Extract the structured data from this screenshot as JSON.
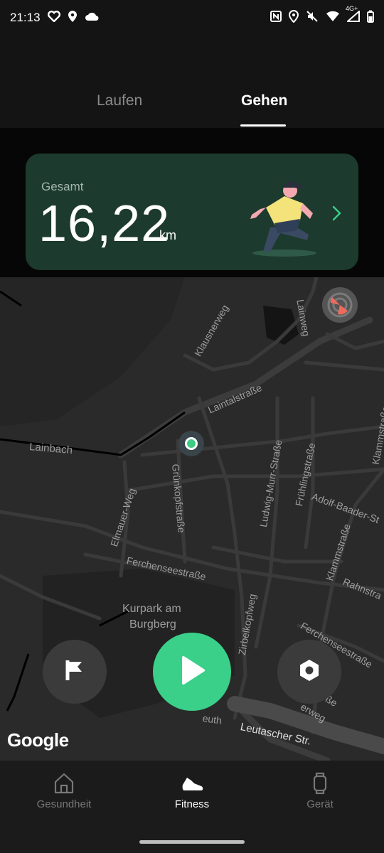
{
  "status_bar": {
    "time": "21:13",
    "left_icons": [
      "heart-icon",
      "location-icon",
      "cloud-icon"
    ],
    "right_icons": [
      "nfc-icon",
      "location-icon",
      "mute-icon",
      "wifi-icon",
      "signal-icon",
      "battery-icon"
    ],
    "network": "4G+"
  },
  "tabs": [
    {
      "label": "Laufen",
      "active": false
    },
    {
      "label": "Gehen",
      "active": true
    }
  ],
  "summary": {
    "label": "Gesamt",
    "value": "16,22",
    "unit": "km"
  },
  "map": {
    "labels": [
      "Klausnerweg",
      "Lainweg",
      "Laintalstraße",
      "Lainbach",
      "Grünkopfstraße",
      "Elmauer-Weg",
      "Ludwig-Murr-Straße",
      "Frühlingstraße",
      "Klammstraße",
      "Adolf-Baader-St",
      "Klammstraße",
      "Rahnstra",
      "Ferchenseestraße",
      "Kurpark am",
      "Burgberg",
      "Zirbelkopfweg",
      "Ferchenseestraße",
      "ße",
      "erweg",
      "euth",
      "Leutascher Str."
    ],
    "attribution": "Google"
  },
  "actions": {
    "flag": "flag-icon",
    "start": "play-icon",
    "settings": "settings-icon"
  },
  "bottom_nav": [
    {
      "label": "Gesundheit",
      "icon": "home-icon",
      "active": false
    },
    {
      "label": "Fitness",
      "icon": "shoe-icon",
      "active": true
    },
    {
      "label": "Gerät",
      "icon": "watch-icon",
      "active": false
    }
  ],
  "colors": {
    "accent": "#3bd08a",
    "card": "#1c3a2d",
    "background": "#0a0a0a"
  }
}
